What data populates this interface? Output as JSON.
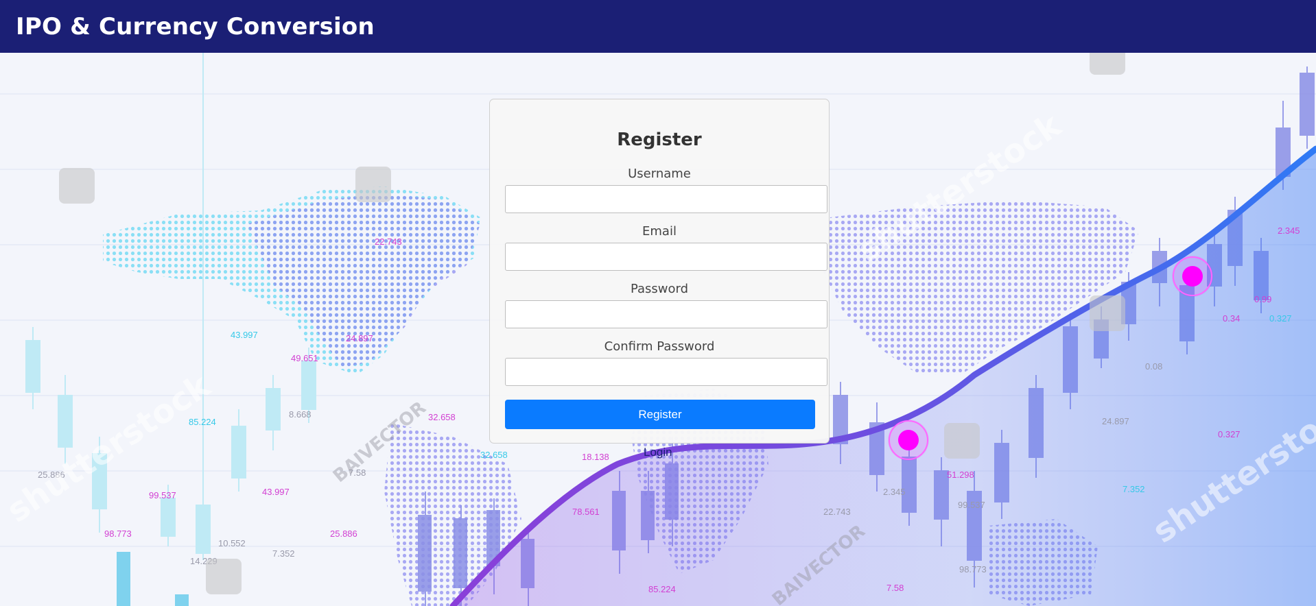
{
  "header": {
    "title": "IPO & Currency Conversion",
    "bg_color": "#1b1f75"
  },
  "form": {
    "title": "Register",
    "fields": [
      {
        "label": "Username",
        "value": "",
        "placeholder": ""
      },
      {
        "label": "Email",
        "value": "",
        "placeholder": ""
      },
      {
        "label": "Password",
        "value": "",
        "placeholder": ""
      },
      {
        "label": "Confirm Password",
        "value": "",
        "placeholder": ""
      }
    ],
    "submit_label": "Register",
    "submit_color": "#0a7bff",
    "login_link": "Login"
  },
  "background": {
    "numbers": [
      "22.743",
      "43.997",
      "24.897",
      "49.651",
      "85.224",
      "8.668",
      "32.658",
      "25.886",
      "99.537",
      "98.773",
      "10.552",
      "7.352",
      "14.229",
      "43.997",
      "25.886",
      "7.58",
      "32.658",
      "18.138",
      "78.561",
      "2.345",
      "22.743",
      "51.298",
      "99.537",
      "98.773",
      "85.224",
      "7.58",
      "24.897",
      "0.327",
      "7.352",
      "0.34",
      "0.327",
      "0.08",
      "0.99",
      "2.345"
    ],
    "watermarks": [
      "shutterstock",
      "BAIVECTOR"
    ],
    "accent_colors": [
      "#ff00ff",
      "#3f7df5",
      "#7a3fe0"
    ]
  }
}
